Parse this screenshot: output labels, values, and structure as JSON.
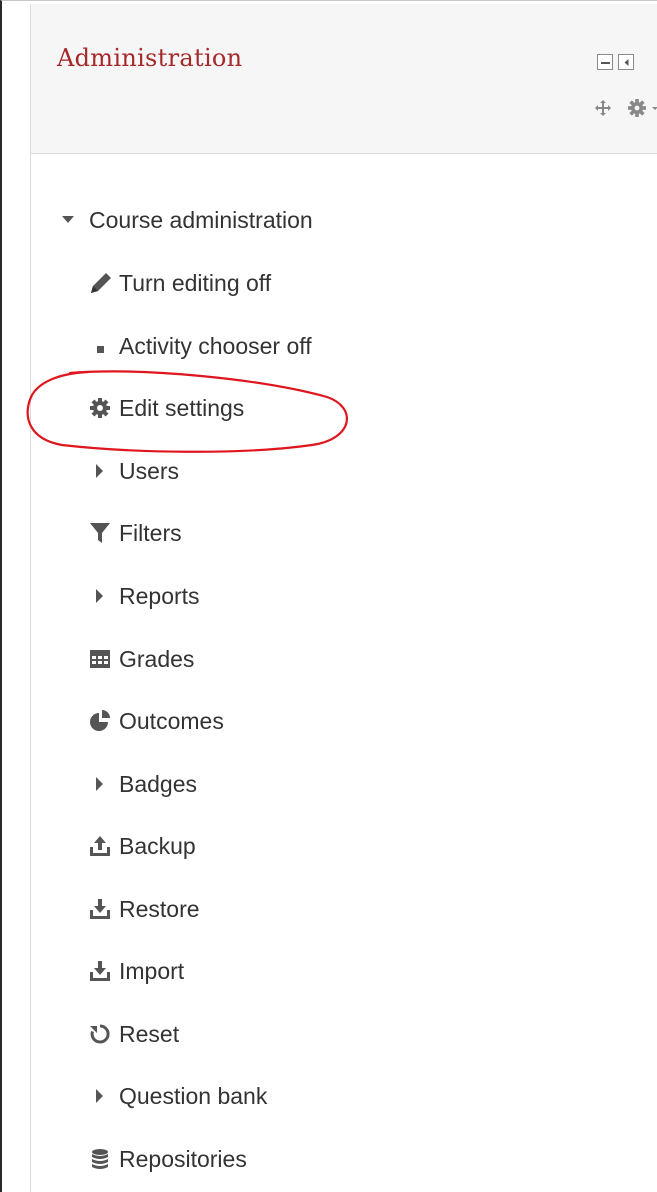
{
  "block": {
    "title": "Administration",
    "controls": {
      "hide_icon": "minus-box-icon",
      "dock_icon": "dock-arrow-icon",
      "move_icon": "move-icon",
      "actions_icon": "gear-menu-icon"
    }
  },
  "nav": {
    "section": {
      "label": "Course administration",
      "icon": "caret-down-icon",
      "expanded": true
    },
    "items": [
      {
        "label": "Turn editing off",
        "icon": "pencil-icon"
      },
      {
        "label": "Activity chooser off",
        "icon": "square-bullet-icon"
      },
      {
        "label": "Edit settings",
        "icon": "gear-icon",
        "highlighted": true
      },
      {
        "label": "Users",
        "icon": "caret-right-icon"
      },
      {
        "label": "Filters",
        "icon": "filter-icon"
      },
      {
        "label": "Reports",
        "icon": "caret-right-icon"
      },
      {
        "label": "Grades",
        "icon": "table-icon"
      },
      {
        "label": "Outcomes",
        "icon": "pie-chart-icon"
      },
      {
        "label": "Badges",
        "icon": "caret-right-icon"
      },
      {
        "label": "Backup",
        "icon": "upload-icon"
      },
      {
        "label": "Restore",
        "icon": "download-icon"
      },
      {
        "label": "Import",
        "icon": "download-icon"
      },
      {
        "label": "Reset",
        "icon": "refresh-icon"
      },
      {
        "label": "Question bank",
        "icon": "caret-right-icon"
      },
      {
        "label": "Repositories",
        "icon": "database-icon"
      }
    ]
  },
  "colors": {
    "title": "#a5282a",
    "text": "#333333",
    "icon": "#555555",
    "annotation": "#e0161e"
  }
}
